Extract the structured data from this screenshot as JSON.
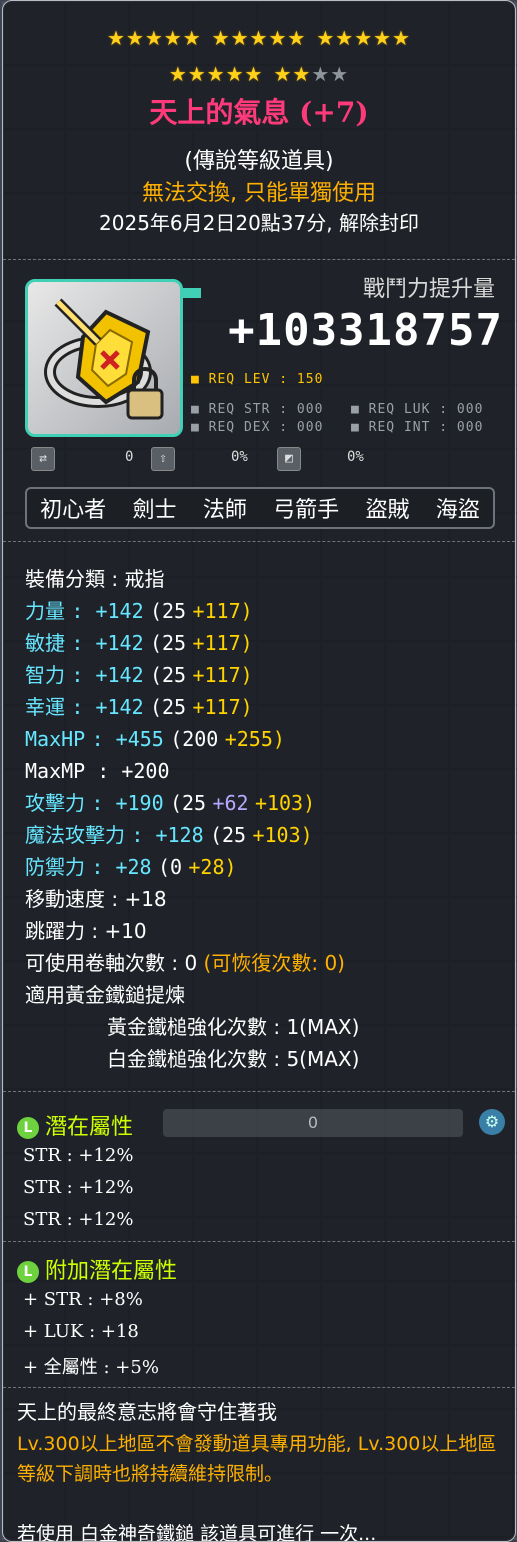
{
  "stars": {
    "row1_filled": 15,
    "row2_filled": 7,
    "row2_total": 9
  },
  "item": {
    "name": "天上的氣息 (+7)",
    "grade": "(傳說等級道具)",
    "trade": "無法交換, 只能單獨使用",
    "unseal": "2025年6月2日20點37分, 解除封印"
  },
  "power": {
    "label": "戰鬥力提升量",
    "value": "+103318757"
  },
  "requirements": {
    "lev": "■ REQ LEV : 150",
    "str": "■ REQ STR : 000",
    "luk": "■ REQ LUK : 000",
    "dex": "■ REQ DEX : 000",
    "int": "■ REQ INT : 000"
  },
  "mini": {
    "slots": "0",
    "pct1": "0%",
    "pct2": "0%"
  },
  "jobs": [
    "初心者",
    "劍士",
    "法師",
    "弓箭手",
    "盜賊",
    "海盜"
  ],
  "stats": {
    "category": "裝備分類 : 戒指",
    "str": {
      "label": "力量",
      "total": ": +142",
      "base": "(25",
      "bonus": "+117)"
    },
    "dex": {
      "label": "敏捷",
      "total": ": +142",
      "base": "(25",
      "bonus": "+117)"
    },
    "int": {
      "label": "智力",
      "total": ": +142",
      "base": "(25",
      "bonus": "+117)"
    },
    "luk": {
      "label": "幸運",
      "total": ": +142",
      "base": "(25",
      "bonus": "+117)"
    },
    "maxhp": {
      "label": "MaxHP",
      "total": ": +455",
      "base": "(200",
      "bonus": "+255)"
    },
    "maxmp": "MaxMP : +200",
    "atk": {
      "label": "攻擊力",
      "total": ": +190",
      "base": "(25",
      "extra": "+62",
      "bonus": "+103)"
    },
    "matk": {
      "label": "魔法攻擊力",
      "total": ": +128",
      "base": "(25",
      "bonus": "+103)"
    },
    "def": {
      "label": "防禦力",
      "total": ": +28",
      "base": "(0",
      "bonus": "+28)"
    },
    "speed": "移動速度 : +18",
    "jump": "跳躍力 : +10",
    "scrolls": "可使用卷軸次數 : 0",
    "recover": "(可恢復次數: 0)",
    "hammer": "適用黃金鐵鎚提煉",
    "gold_hammer": "黃金鐵槌強化次數 : 1(MAX)",
    "plat_hammer": "白金鐵槌強化次數 : 5(MAX)"
  },
  "potential": {
    "title": "潛在屬性",
    "lines": [
      "STR : +12%",
      "STR : +12%",
      "STR : +12%"
    ]
  },
  "bonus_potential": {
    "title": "附加潛在屬性",
    "lines": [
      "+ STR : +8%",
      "+ LUK : +18",
      "+ 全屬性 : +5%"
    ]
  },
  "description": {
    "line1": "天上的最終意志將會守住著我",
    "line2": "Lv.300以上地區不會發動道具專用功能, Lv.300以上地區等級下調時也將持續維持限制。",
    "bottom": "若使用 白金神奇鐵鎚 該道具可進行 一次..."
  },
  "input_value": "0",
  "colors": {
    "title": "#ff3a7a",
    "cyan": "#66e6ff",
    "yellow": "#ffd200",
    "green": "#ccff00",
    "orange": "#ffb000"
  }
}
